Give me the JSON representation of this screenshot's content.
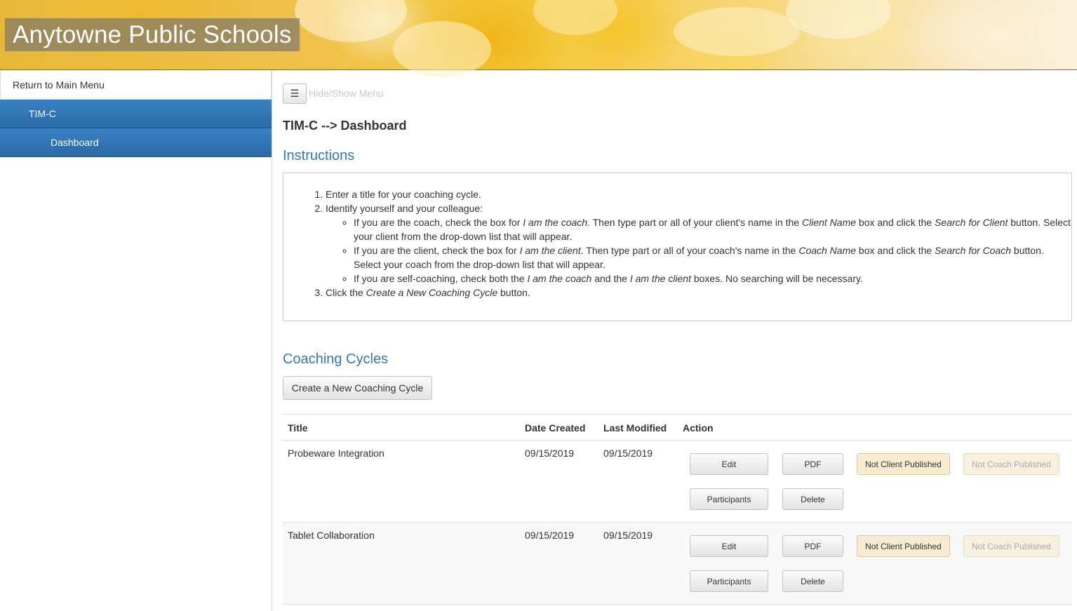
{
  "header": {
    "title": "Anytowne Public Schools"
  },
  "sidebar": {
    "return_label": "Return to Main Menu",
    "section_label": "TIM-C",
    "dashboard_label": "Dashboard"
  },
  "toolbar": {
    "menu_icon": "☰",
    "menu_label": "Hide/Show Menu"
  },
  "page": {
    "title": "TIM-C --> Dashboard"
  },
  "instructions": {
    "heading": "Instructions",
    "step1": "Enter a title for your coaching cycle.",
    "step2": "Identify yourself and your colleague:",
    "b1_a": "If you are the coach, check the box for ",
    "b1_b": "I am the coach.",
    "b1_c": " Then type part or all of your client's name in the ",
    "b1_d": "Client Name",
    "b1_e": " box and click the ",
    "b1_f": "Search for Client",
    "b1_g": " button. Select your client from the drop-down list that will appear.",
    "b2_a": "If you are the client, check the box for ",
    "b2_b": "I am the client.",
    "b2_c": " Then type part or all of your coach's name in the ",
    "b2_d": "Coach Name",
    "b2_e": " box and click the ",
    "b2_f": "Search for Coach",
    "b2_g": " button. Select your coach from the drop-down list that will appear.",
    "b3_a": "If you are self-coaching, check both the ",
    "b3_b": "I am the coach",
    "b3_c": " and the ",
    "b3_d": "I am the client",
    "b3_e": " boxes. No searching will be necessary.",
    "step3_a": "Click the ",
    "step3_b": "Create a New Coaching Cycle",
    "step3_c": " button."
  },
  "cycles": {
    "heading": "Coaching Cycles",
    "create_label": "Create a New Coaching Cycle",
    "columns": {
      "title": "Title",
      "created": "Date Created",
      "modified": "Last Modified",
      "action": "Action"
    },
    "rows": [
      {
        "title": "Probeware Integration",
        "created": "09/15/2019",
        "modified": "09/15/2019"
      },
      {
        "title": "Tablet Collaboration",
        "created": "09/15/2019",
        "modified": "09/15/2019"
      }
    ],
    "actions": {
      "edit": "Edit",
      "pdf": "PDF",
      "not_client": "Not Client Published",
      "not_coach": "Not Coach Published",
      "participants": "Participants",
      "delete": "Delete"
    }
  }
}
